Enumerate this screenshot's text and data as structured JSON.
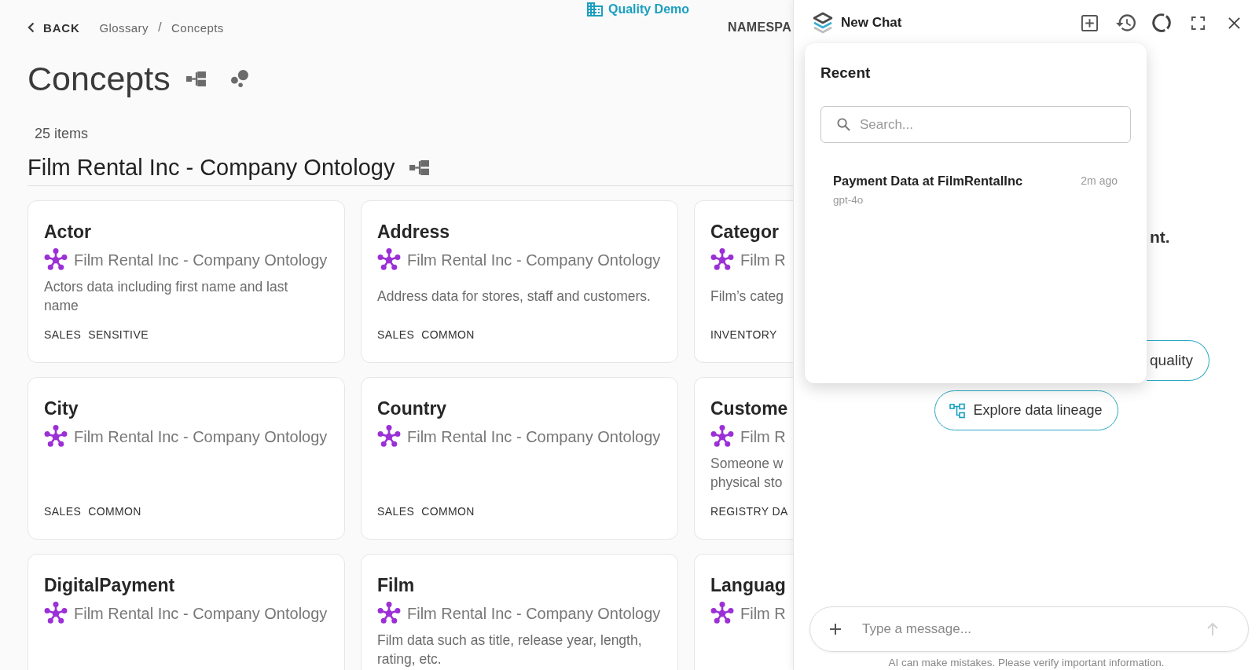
{
  "header": {
    "back": "BACK",
    "breadcrumb": [
      {
        "label": "Glossary"
      },
      {
        "label": "Concepts"
      }
    ],
    "separator": "/",
    "workspace": "Quality Demo",
    "namespace": "NAMESPA"
  },
  "page": {
    "title": "Concepts",
    "count": "25 items"
  },
  "ontology": {
    "title": "Film Rental Inc - Company Ontology",
    "concepts": [
      {
        "title": "Actor",
        "ontology": "Film Rental Inc - Company Ontology",
        "description_lines": [
          "Actors data including first name and last",
          "name"
        ],
        "tags": [
          "SALES",
          "SENSITIVE"
        ]
      },
      {
        "title": "Address",
        "ontology": "Film Rental Inc - Company Ontology",
        "description_lines": [
          "Address data for stores, staff and customers."
        ],
        "tags": [
          "SALES",
          "COMMON"
        ]
      },
      {
        "title": "Categor",
        "ontology": "Film R",
        "description_lines": [
          "Film’s categ"
        ],
        "tags": [
          "INVENTORY"
        ]
      },
      {
        "title": "City",
        "ontology": "Film Rental Inc - Company Ontology",
        "tags": [
          "SALES",
          "COMMON"
        ]
      },
      {
        "title": "Country",
        "ontology": "Film Rental Inc - Company Ontology",
        "tags": [
          "SALES",
          "COMMON"
        ]
      },
      {
        "title": "Custome",
        "ontology": "Film R",
        "description_lines": [
          "Someone w",
          "physical sto"
        ],
        "tags": [
          "REGISTRY DA"
        ]
      },
      {
        "title": "DigitalPayment",
        "ontology": "Film Rental Inc - Company Ontology"
      },
      {
        "title": "Film",
        "ontology": "Film Rental Inc - Company Ontology",
        "description_lines": [
          "Film data such as title, release year, length,",
          "rating, etc."
        ]
      },
      {
        "title": "Languag",
        "ontology": "Film R"
      }
    ]
  },
  "chat": {
    "title": "New Chat",
    "partial_heading": "nt.",
    "partial_suggestion": "quality",
    "suggestions": [
      {
        "label": "Explore data lineage"
      }
    ],
    "input_placeholder": "Type a message...",
    "send_button": {
      "disabled": true
    },
    "disclaimer": "AI can make mistakes. Please verify important information.",
    "recent": {
      "title": "Recent",
      "search_placeholder": "Search...",
      "items": [
        {
          "title": "Payment Data at FilmRentalInc",
          "time": "2m ago",
          "model": "gpt-4o"
        }
      ]
    }
  }
}
